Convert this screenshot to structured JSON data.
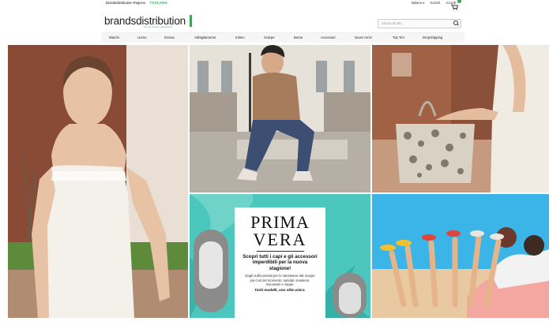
{
  "topbar": {
    "region_label": "Brandsdistribution Regione",
    "region_value": "TOSCANA",
    "language": "Italiano ▾",
    "signup": "Iscriviti",
    "login": "Accedi"
  },
  "logo": {
    "name": "brandsdistribution",
    "tagline": "the big brands marketplace"
  },
  "search": {
    "placeholder": "Cerca nel sito"
  },
  "nav": {
    "items": [
      "Marchi",
      "Uomo",
      "Donna",
      "Abbigliamento",
      "Intimo",
      "Scarpe",
      "Borse",
      "Accessori",
      "Nuovi Arrivi",
      "Top Ten",
      "Dropshipping"
    ]
  },
  "promo": {
    "title1": "PRIMA",
    "title2": "VERA",
    "subtitle": "Scopri tutti i capi e gli accessori imperdibili per la nuova stagione!",
    "body": "Dagli outfit pensati per lo streetwear alle scarpe più cool del momento: sandali, sneakers, mocassini e zeppe.",
    "cta": "Tanti modelli, uno stile unico."
  },
  "colors": {
    "accent": "#3aa35a",
    "teal": "#49c6bf",
    "sky": "#35b6e9"
  }
}
